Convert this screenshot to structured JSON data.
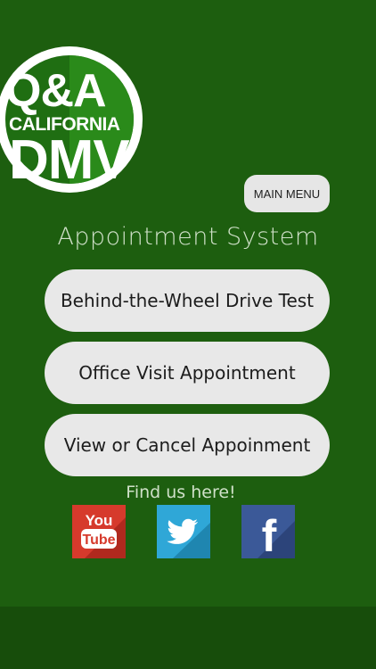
{
  "logo": {
    "line1": "Q&A",
    "line2": "CALIFORNIA",
    "line3": "DMV"
  },
  "header": {
    "menu_label": "MAIN MENU"
  },
  "main": {
    "title": "Appointment System",
    "buttons": [
      {
        "label": "Behind-the-Wheel Drive Test"
      },
      {
        "label": "Office Visit Appointment"
      },
      {
        "label": "View or Cancel Appoinment"
      }
    ]
  },
  "social": {
    "title": "Find us here!",
    "icons": [
      {
        "name": "youtube-icon",
        "text_top": "You",
        "text_bottom": "Tube"
      },
      {
        "name": "twitter-icon"
      },
      {
        "name": "facebook-icon",
        "text": "f"
      }
    ]
  },
  "colors": {
    "background": "#1d5e0f",
    "bottom_bar": "#174d0b",
    "button_bg": "#e8e8e8",
    "youtube_red": "#d63a2c",
    "twitter_blue": "#2fa7d7",
    "facebook_blue": "#3b5998"
  }
}
